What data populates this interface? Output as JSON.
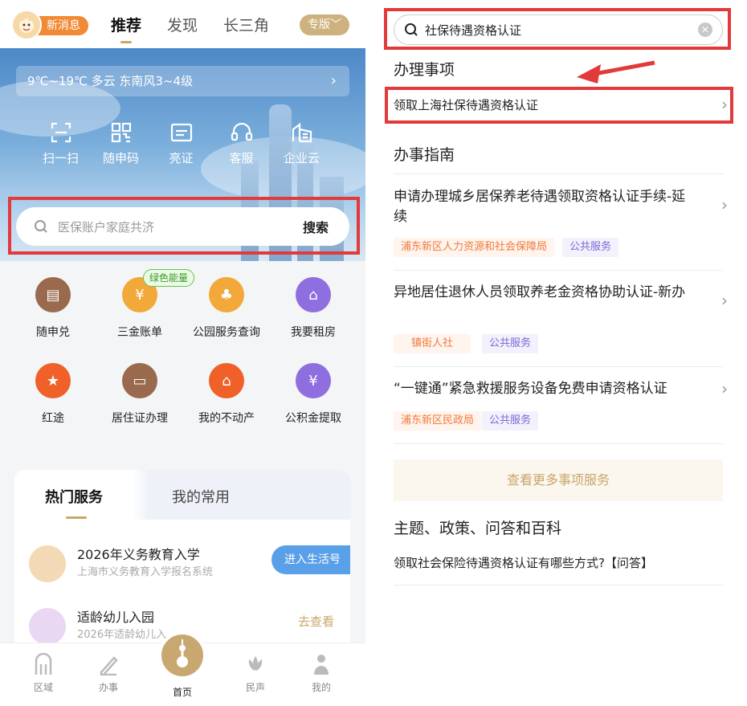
{
  "left": {
    "badge": {
      "label": "新消息"
    },
    "tabs": [
      "推荐",
      "发现",
      "长三角"
    ],
    "edition": "专版",
    "weather": "9℃~19℃ 多云 东南风3~4级",
    "quick_actions": [
      {
        "label": "扫一扫",
        "icon": "scan-icon"
      },
      {
        "label": "随申码",
        "icon": "qr-code-icon"
      },
      {
        "label": "亮证",
        "icon": "id-card-icon"
      },
      {
        "label": "客服",
        "icon": "headset-icon"
      },
      {
        "label": "企业云",
        "icon": "building-icon"
      }
    ],
    "search": {
      "placeholder": "医保账户家庭共济",
      "button": "搜索"
    },
    "grid": [
      {
        "label": "随申兑",
        "color": "#9a6a4e"
      },
      {
        "label": "三金账单",
        "color": "#f3a83a",
        "tag": "绿色能量"
      },
      {
        "label": "公园服务查询",
        "color": "#f3a83a"
      },
      {
        "label": "我要租房",
        "color": "#8f6fe0"
      },
      {
        "label": "红途",
        "color": "#f0612a"
      },
      {
        "label": "居住证办理",
        "color": "#9a6a4e"
      },
      {
        "label": "我的不动产",
        "color": "#f0612a"
      },
      {
        "label": "公积金提取",
        "color": "#8f6fe0"
      }
    ],
    "services": {
      "tab_hot": "热门服务",
      "tab_mine": "我的常用",
      "items": [
        {
          "title": "2026年义务教育入学",
          "subtitle": "上海市义务教育入学报名系统",
          "action": "进入生活号"
        },
        {
          "title": "适龄幼儿入园",
          "subtitle": "2026年适龄幼儿入",
          "action": "去查看"
        }
      ]
    },
    "bottom_nav": [
      "区域",
      "办事",
      "首页",
      "民声",
      "我的"
    ]
  },
  "right": {
    "search_value": "社保待遇资格认证",
    "section_affairs": "办理事项",
    "affair_item": "领取上海社保待遇资格认证",
    "section_guide": "办事指南",
    "guides": [
      {
        "title": "申请办理城乡居保养老待遇领取资格认证手续-延续",
        "org": "浦东新区人力资源和社会保障局",
        "type": "公共服务"
      },
      {
        "title": "异地居住退休人员领取养老金资格协助认证-新办",
        "org": "镇街人社",
        "type": "公共服务"
      },
      {
        "title": "“一键通”紧急救援服务设备免费申请资格认证",
        "org": "浦东新区民政局",
        "type": "公共服务"
      }
    ],
    "more_button": "查看更多事项服务",
    "section_topics": "主题、政策、问答和百科",
    "qa_item": "领取社会保险待遇资格认证有哪些方式?【问答】"
  }
}
